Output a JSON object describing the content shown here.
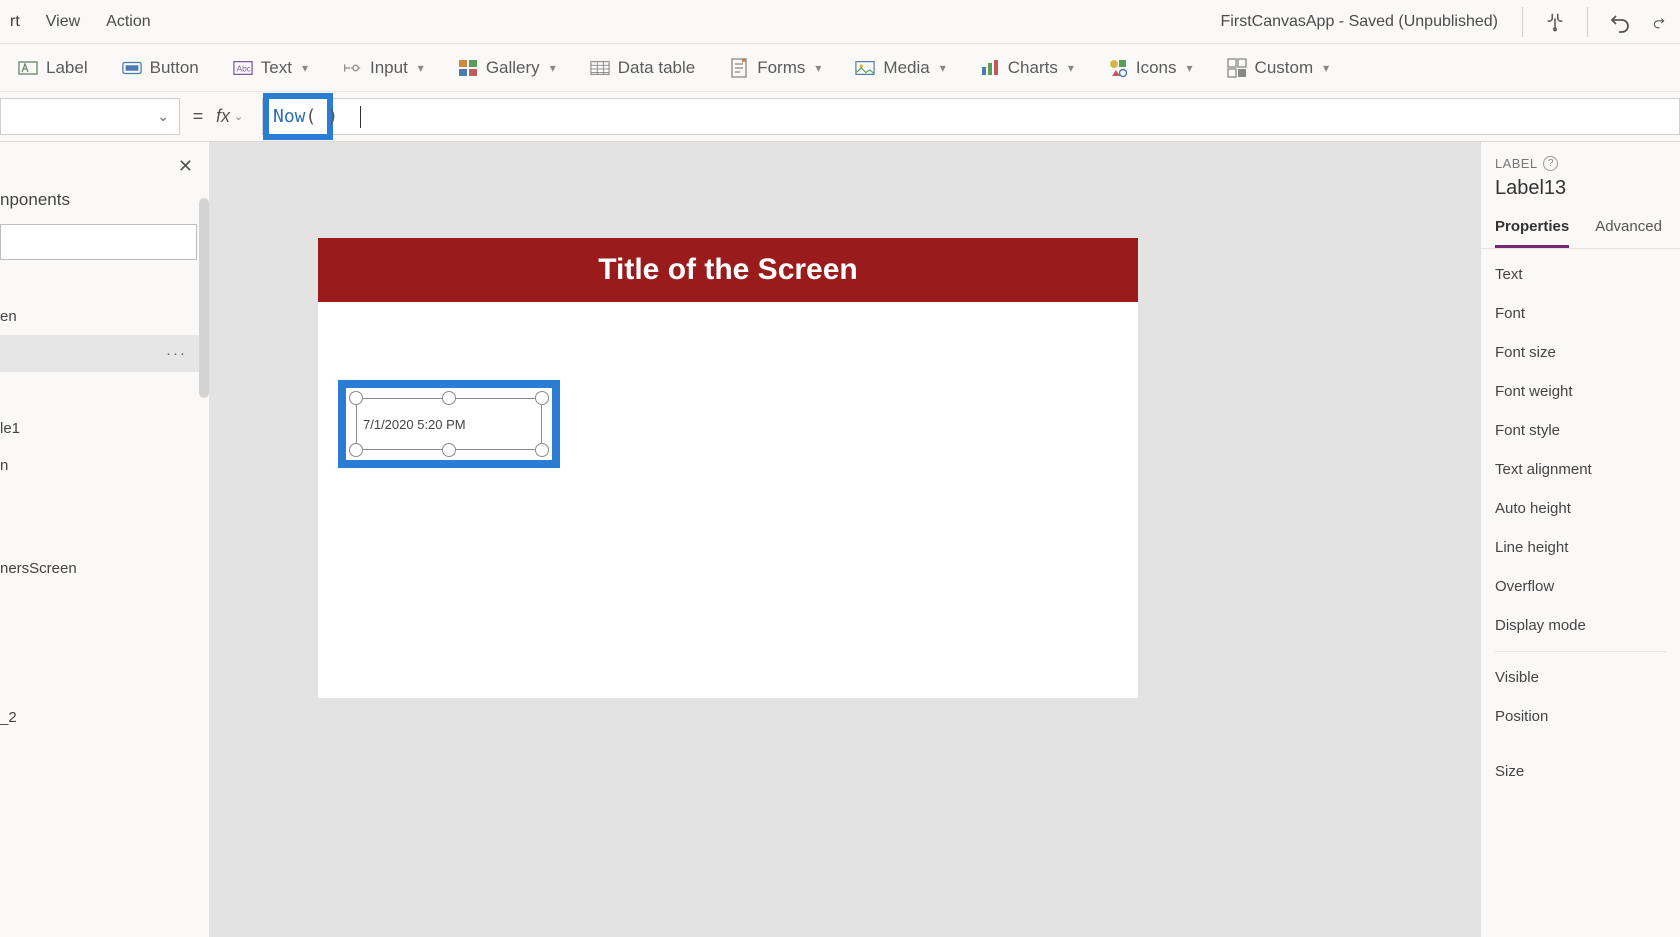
{
  "topbar": {
    "menus": [
      "rt",
      "View",
      "Action"
    ],
    "app_title": "FirstCanvasApp - Saved (Unpublished)"
  },
  "ribbon": {
    "label": "Label",
    "button": "Button",
    "text": "Text",
    "input": "Input",
    "gallery": "Gallery",
    "data_table": "Data table",
    "forms": "Forms",
    "media": "Media",
    "charts": "Charts",
    "icons": "Icons",
    "custom": "Custom"
  },
  "formula": {
    "equals": "=",
    "fx": "fx",
    "function_name": "Now",
    "parens": "( )"
  },
  "left": {
    "tab": "nponents",
    "items": [
      "en",
      "",
      "le1",
      "n",
      "nersScreen",
      "_2"
    ]
  },
  "canvas": {
    "title": "Title of the Screen",
    "label_value": "7/1/2020 5:20 PM"
  },
  "right": {
    "type": "LABEL",
    "name": "Label13",
    "tabs": {
      "properties": "Properties",
      "advanced": "Advanced"
    },
    "props": [
      "Text",
      "Font",
      "Font size",
      "Font weight",
      "Font style",
      "Text alignment",
      "Auto height",
      "Line height",
      "Overflow",
      "Display mode"
    ],
    "props2": [
      "Visible",
      "Position",
      "Size"
    ]
  }
}
